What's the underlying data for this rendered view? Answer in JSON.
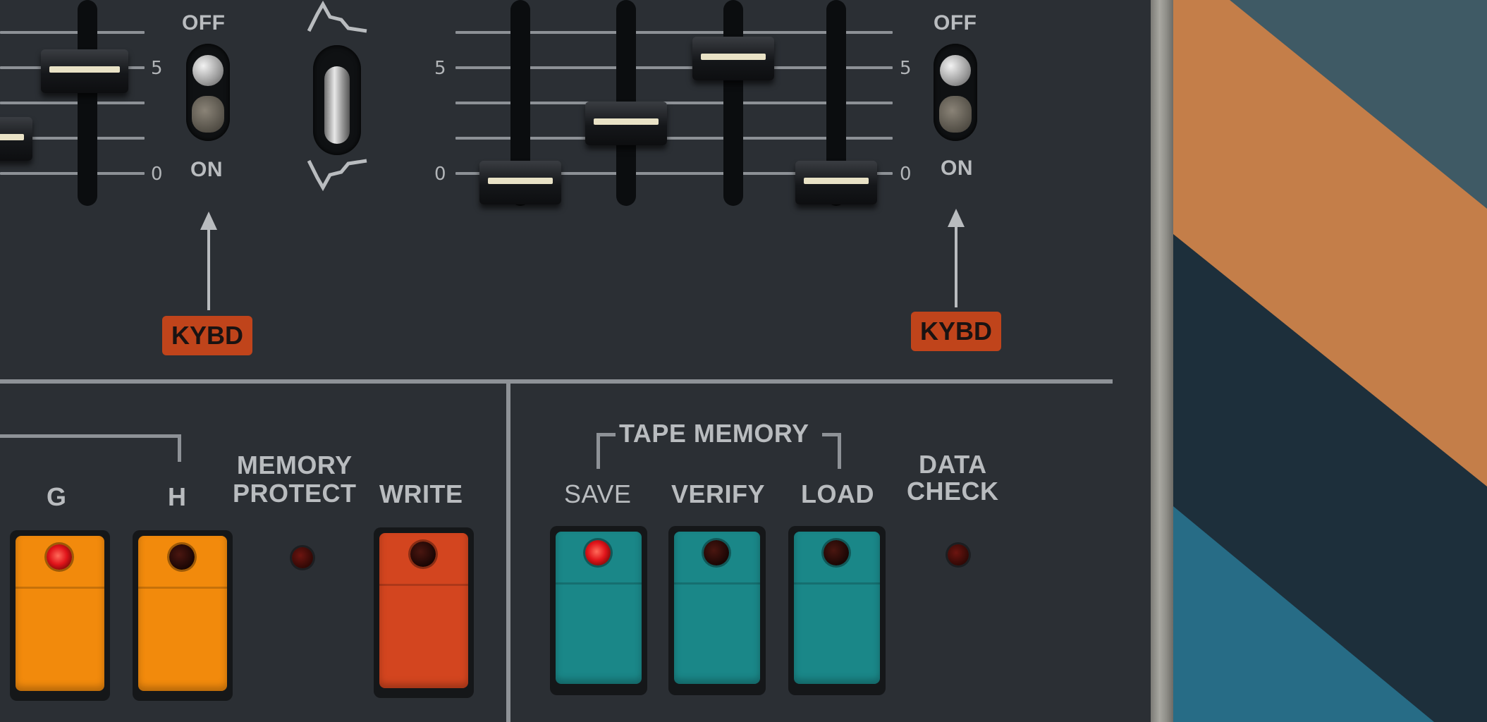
{
  "scale_left": {
    "five": "5",
    "zero": "0"
  },
  "scale_mid": {
    "five": "5",
    "zero": "0"
  },
  "scale_right": {
    "five": "5",
    "zero": "0"
  },
  "switch_left": {
    "off": "OFF",
    "on": "ON",
    "kybd": "KYBD"
  },
  "switch_right": {
    "off": "OFF",
    "on": "ON",
    "kybd": "KYBD"
  },
  "memory": {
    "g": "G",
    "h": "H",
    "protect_1": "MEMORY",
    "protect_2": "PROTECT",
    "write": "WRITE"
  },
  "tape": {
    "title": "TAPE MEMORY",
    "save": "SAVE",
    "verify": "VERIFY",
    "load": "LOAD",
    "check_1": "DATA",
    "check_2": "CHECK"
  },
  "colors": {
    "panel": "#2b2f34",
    "orange": "#f28a0c",
    "red": "#d3451f",
    "teal": "#1a8788",
    "stripe_orange": "#c47e49",
    "stripe_slate": "#3f5a65",
    "stripe_navy": "#1d2f3b",
    "stripe_blue": "#276c86"
  }
}
